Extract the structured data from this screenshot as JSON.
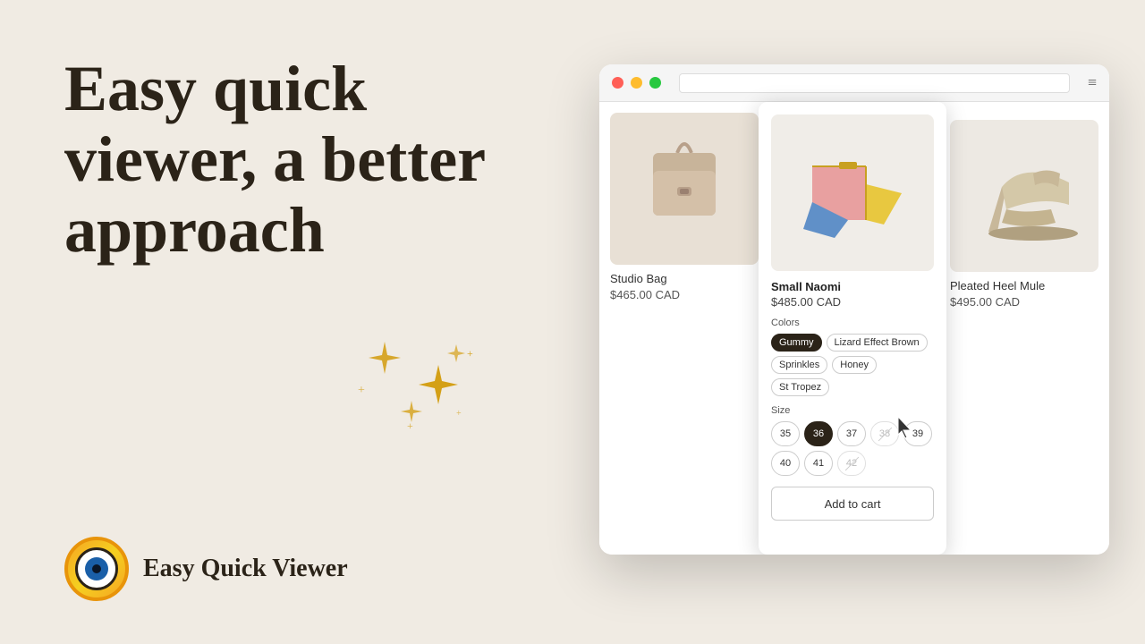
{
  "heading": {
    "line1": "Easy quick",
    "line2": "viewer, a better",
    "line3": "approach"
  },
  "logo": {
    "text": "Easy Quick Viewer"
  },
  "browser": {
    "dots": [
      "red",
      "yellow",
      "green"
    ],
    "menu_icon": "≡"
  },
  "products": {
    "studio_bag": {
      "name": "Studio Bag",
      "price": "$465.00 CAD"
    },
    "small_naomi": {
      "name": "Small Naomi",
      "price": "$485.00 CAD",
      "colors_label": "Colors",
      "colors": [
        "Gummy",
        "Lizard Effect Brown",
        "Sprinkles",
        "Honey",
        "St Tropez"
      ],
      "active_color": "Gummy",
      "size_label": "Size",
      "sizes": [
        "35",
        "36",
        "37",
        "38",
        "39",
        "40",
        "41",
        "42"
      ],
      "active_size": "36",
      "disabled_sizes": [
        "38",
        "42"
      ],
      "add_to_cart": "Add to cart"
    },
    "heel_mule": {
      "name": "Pleated Heel Mule",
      "price": "$495.00 CAD"
    }
  }
}
